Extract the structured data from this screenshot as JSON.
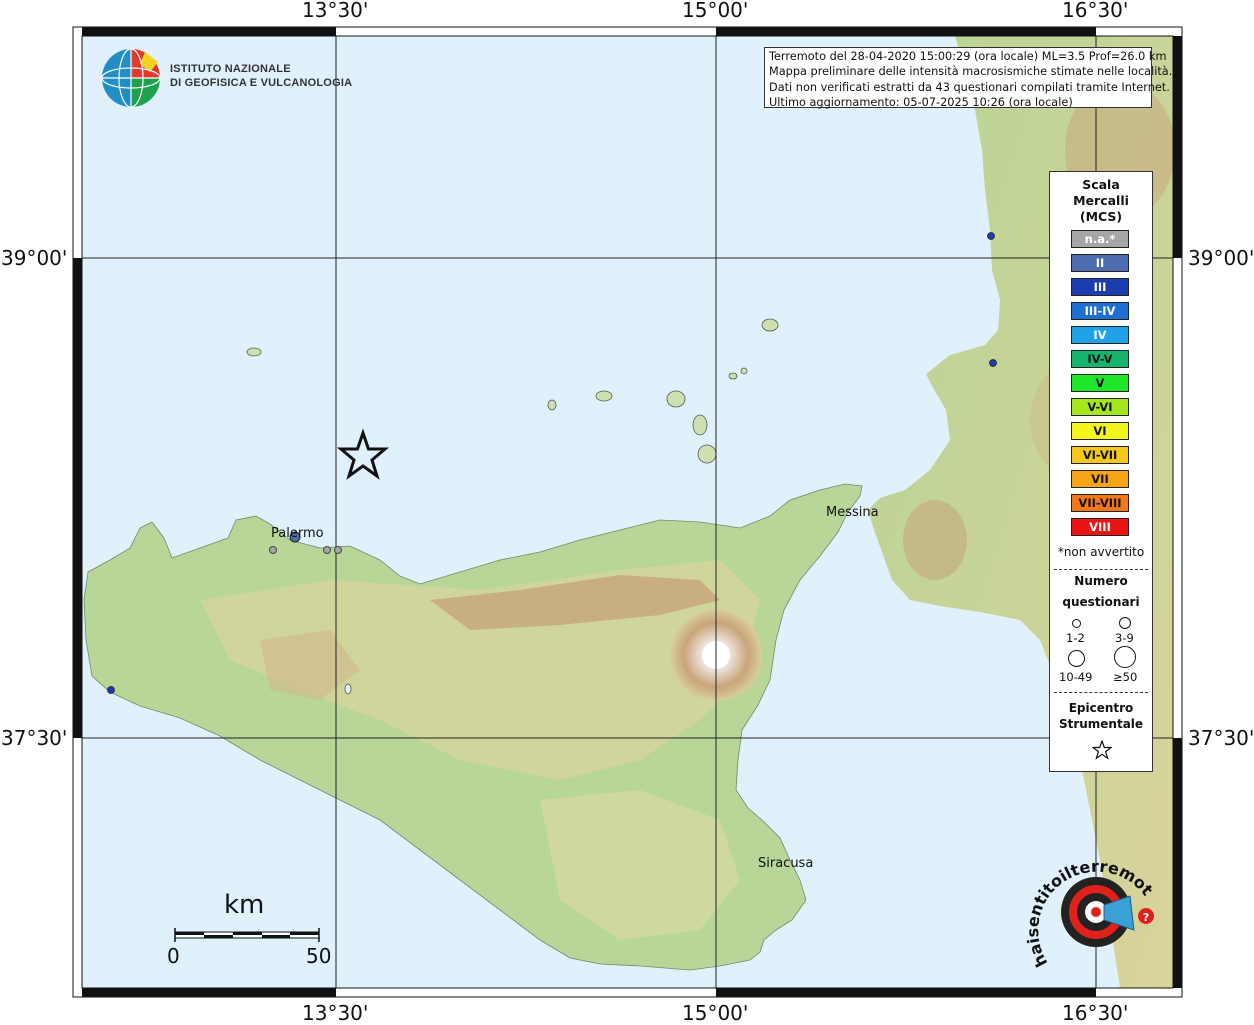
{
  "logo": {
    "name_line1": "ISTITUTO NAZIONALE",
    "name_line2": "DI GEOFISICA E VULCANOLOGIA",
    "icon": "ingv-globe-icon"
  },
  "info": {
    "line1": "Terremoto del 28-04-2020 15:00:29 (ora locale) ML=3.5 Prof=26.0 km",
    "line2": "Mappa preliminare delle intensità macrosismiche stimate nelle località.",
    "line3": "Dati non verificati estratti da 43 questionari compilati tramite Internet.",
    "line4": "Ultimo aggiornamento: 05-07-2025 10:26 (ora locale)"
  },
  "ticks": {
    "lon": [
      "13°30'",
      "15°00'",
      "16°30'"
    ],
    "lat": [
      "39°00'",
      "37°30'"
    ]
  },
  "cities": {
    "palermo": "Palermo",
    "messina": "Messina",
    "siracusa": "Siracusa"
  },
  "legend": {
    "title1": "Scala",
    "title2": "Mercalli",
    "title3": "(MCS)",
    "classes": [
      {
        "label": "n.a.*",
        "color": "#a6a6a6",
        "text_color": "#ffffff"
      },
      {
        "label": "II",
        "color": "#4e6db0",
        "text_color": "#ffffff"
      },
      {
        "label": "III",
        "color": "#1c3cb0",
        "text_color": "#ffffff"
      },
      {
        "label": "III-IV",
        "color": "#1f6fd2",
        "text_color": "#ffffff"
      },
      {
        "label": "IV",
        "color": "#1fa2e8",
        "text_color": "#ffffff"
      },
      {
        "label": "IV-V",
        "color": "#14b46e",
        "text_color": "#111111"
      },
      {
        "label": "V",
        "color": "#1ee628",
        "text_color": "#111111"
      },
      {
        "label": "V-VI",
        "color": "#a5e61e",
        "text_color": "#111111"
      },
      {
        "label": "VI",
        "color": "#f5f51e",
        "text_color": "#111111"
      },
      {
        "label": "VI-VII",
        "color": "#f5c81e",
        "text_color": "#111111"
      },
      {
        "label": "VII",
        "color": "#f5a514",
        "text_color": "#111111"
      },
      {
        "label": "VII-VIII",
        "color": "#f57814",
        "text_color": "#111111"
      },
      {
        "label": "VIII",
        "color": "#eb1414",
        "text_color": "#ffffff"
      }
    ],
    "not_felt_note": "*non avvertito",
    "count_title1": "Numero",
    "count_title2": "questionari",
    "count_classes": [
      "1-2",
      "3-9",
      "10-49",
      "≥50"
    ],
    "epicenter_title1": "Epicentro",
    "epicenter_title2": "Strumentale",
    "epicenter_icon": "star-icon"
  },
  "scale_bar": {
    "unit": "km",
    "min": "0",
    "max": "50"
  },
  "watermark": {
    "site": "haisentitoilterremoto.it",
    "icon": "target-megaphone-icon"
  },
  "colors": {
    "sea": "#e1f1fb",
    "land_low": "#a7cf8e",
    "land_mid": "#e6dca3",
    "land_high": "#b8926b",
    "epicenter": "#111111",
    "report_blue": "#1c3cb0",
    "report_grey": "#a6a6a6"
  }
}
